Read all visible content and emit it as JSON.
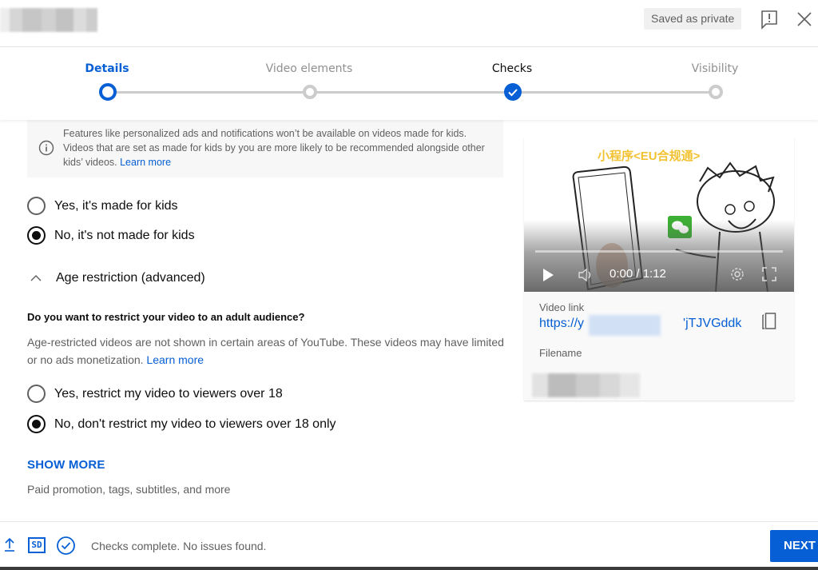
{
  "header": {
    "saved_badge": "Saved as private",
    "feedback_icon": "feedback-icon",
    "close_icon": "close-icon"
  },
  "stepper": {
    "steps": [
      {
        "label": "Details",
        "state": "active"
      },
      {
        "label": "Video elements",
        "state": "pending"
      },
      {
        "label": "Checks",
        "state": "done"
      },
      {
        "label": "Visibility",
        "state": "pending"
      }
    ]
  },
  "audience": {
    "info_text": "Features like personalized ads and notifications won’t be available on videos made for kids. Videos that are set as made for kids by you are more likely to be recommended alongside other kids’ videos.",
    "info_link": "Learn more",
    "options": [
      {
        "label": "Yes, it's made for kids",
        "selected": false
      },
      {
        "label": "No, it's not made for kids",
        "selected": true
      }
    ]
  },
  "age_restriction": {
    "section_title": "Age restriction (advanced)",
    "question": "Do you want to restrict your video to an adult audience?",
    "description": "Age-restricted videos are not shown in certain areas of YouTube. These videos may have limited or no ads monetization.",
    "link": "Learn more",
    "options": [
      {
        "label": "Yes, restrict my video to viewers over 18",
        "selected": false
      },
      {
        "label": "No, don't restrict my video to viewers over 18 only",
        "selected": true
      }
    ]
  },
  "show_more": {
    "label": "SHOW MORE",
    "subtitle": "Paid promotion, tags, subtitles, and more"
  },
  "video_card": {
    "video_title": "小程序<EU合规通>",
    "time": "0:00 / 1:12",
    "progress_fraction": 0,
    "video_link_label": "Video link",
    "video_link_prefix": "https://y",
    "video_link_suffix": "'jTJVGddk",
    "filename_label": "Filename"
  },
  "footer": {
    "status": "Checks complete. No issues found.",
    "next_label": "NEXT",
    "quality_badge": "SD"
  },
  "colors": {
    "accent": "#065fd4",
    "muted_text": "#606060",
    "inactive_step": "#cccccc"
  }
}
